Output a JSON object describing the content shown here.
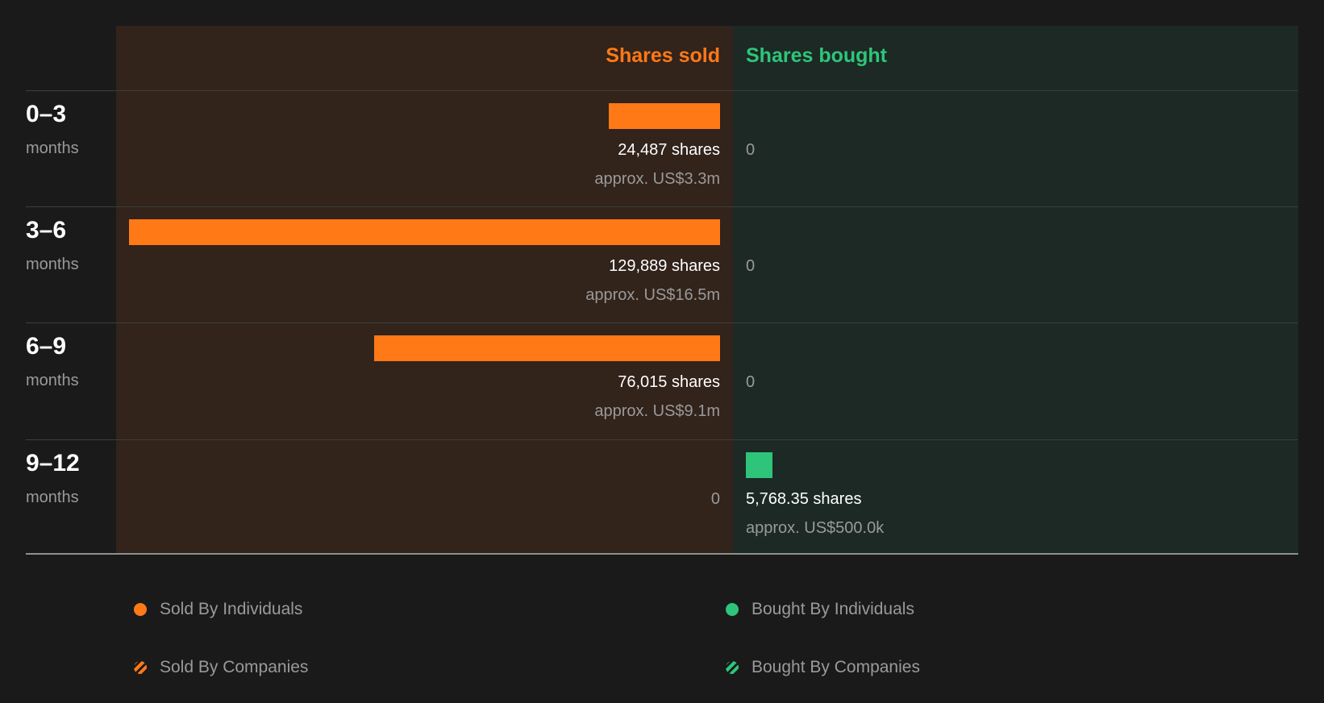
{
  "header": {
    "sold_label": "Shares sold",
    "bought_label": "Shares bought"
  },
  "colors": {
    "sold": "#ff7917",
    "bought": "#2ec57a"
  },
  "chart_data": {
    "type": "bar",
    "orientation": "horizontal-diverging",
    "categories": [
      "0-3",
      "3-6",
      "6-9",
      "9-12"
    ],
    "series": [
      {
        "name": "Shares sold",
        "values": [
          24487,
          129889,
          76015,
          0
        ]
      },
      {
        "name": "Shares bought",
        "values": [
          0,
          0,
          0,
          5768.35
        ]
      }
    ]
  },
  "periods": [
    {
      "label": "0–3",
      "unit": "months",
      "sold": {
        "value": 24487,
        "shares": "24,487 shares",
        "approx": "approx. US$3.3m",
        "zero": ""
      },
      "bought": {
        "value": 0,
        "shares": "",
        "approx": "",
        "zero": "0"
      }
    },
    {
      "label": "3–6",
      "unit": "months",
      "sold": {
        "value": 129889,
        "shares": "129,889 shares",
        "approx": "approx. US$16.5m",
        "zero": ""
      },
      "bought": {
        "value": 0,
        "shares": "",
        "approx": "",
        "zero": "0"
      }
    },
    {
      "label": "6–9",
      "unit": "months",
      "sold": {
        "value": 76015,
        "shares": "76,015 shares",
        "approx": "approx. US$9.1m",
        "zero": ""
      },
      "bought": {
        "value": 0,
        "shares": "",
        "approx": "",
        "zero": "0"
      }
    },
    {
      "label": "9–12",
      "unit": "months",
      "sold": {
        "value": 0,
        "shares": "",
        "approx": "",
        "zero": "0"
      },
      "bought": {
        "value": 5768.35,
        "shares": "5,768.35 shares",
        "approx": "approx. US$500.0k",
        "zero": ""
      }
    }
  ],
  "legend": [
    {
      "label": "Sold By Individuals",
      "color": "#ff7917",
      "pattern": "solid"
    },
    {
      "label": "Bought By Individuals",
      "color": "#2ec57a",
      "pattern": "solid"
    },
    {
      "label": "Sold By Companies",
      "color": "#ff7917",
      "pattern": "striped"
    },
    {
      "label": "Bought By Companies",
      "color": "#2ec57a",
      "pattern": "striped"
    }
  ]
}
